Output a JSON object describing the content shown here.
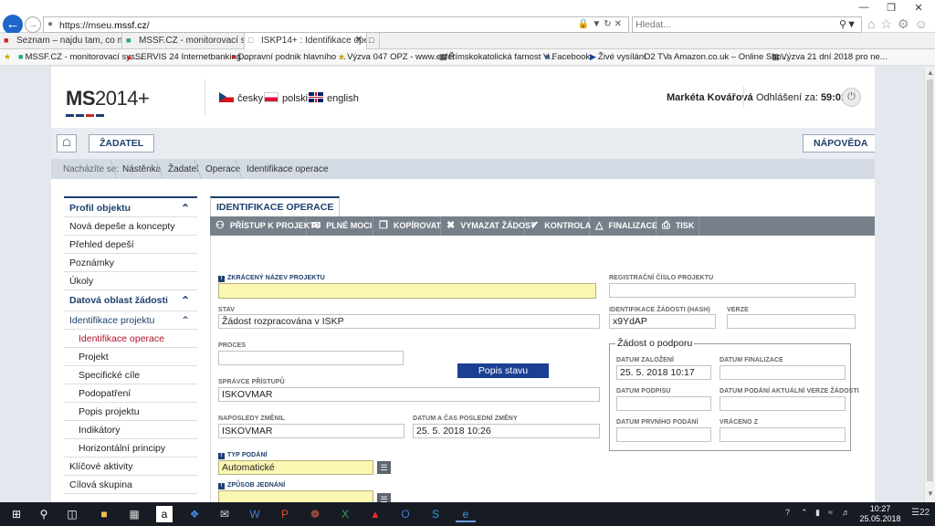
{
  "browser": {
    "url_prefix": "https://mseu.",
    "url_domain": "mssf.cz",
    "url_suffix": "/",
    "search_placeholder": "Hledat...",
    "tabs": [
      {
        "label": "Seznam – najdu tam, co neznám"
      },
      {
        "label": "MSSF.CZ - monitorovací syste..."
      },
      {
        "label": "ISKP14+ : Identifikace oper"
      }
    ],
    "favorites": [
      {
        "label": "MSSF.CZ - monitorovací sys..."
      },
      {
        "label": "SERVIS 24 Internetbanking ..."
      },
      {
        "label": "Dopravní podnik hlavního ..."
      },
      {
        "label": "Výzva 047 OPZ - www.esfcr"
      },
      {
        "label": "Římskokatolická farnost V..."
      },
      {
        "label": "Facebook"
      },
      {
        "label": "Živé vysílání"
      },
      {
        "label": "O2 TV"
      },
      {
        "label": "Amazon.co.uk – Online Sho..."
      },
      {
        "label": "Výzva 21 dní 2018 pro ne..."
      }
    ]
  },
  "header": {
    "logo_prefix": "MS",
    "logo_suffix": "2014+",
    "languages": [
      "česky",
      "polski",
      "english"
    ],
    "user": "Markéta Kovářová",
    "logout_label": "Odhlášení za:",
    "logout_time": "59:01"
  },
  "toolbar": {
    "zadatel": "ŽADATEL",
    "napoveda": "NÁPOVĚDA"
  },
  "breadcrumb": {
    "label": "Nacházíte se:",
    "items": [
      "Nástěnka",
      "Žadatel",
      "Operace",
      "Identifikace operace"
    ]
  },
  "sidebar": {
    "profil": "Profil objektu",
    "items1": [
      "Nová depeše a koncepty",
      "Přehled depeší",
      "Poznámky",
      "Úkoly"
    ],
    "datova": "Datová oblast žádosti",
    "identifikace_projektu": "Identifikace projektu",
    "sub": [
      "Identifikace operace",
      "Projekt",
      "Specifické cíle",
      "Podopatření",
      "Popis projektu",
      "Indikátory",
      "Horizontální principy"
    ],
    "items2": [
      "Klíčové aktivity",
      "Cílová skupina"
    ]
  },
  "content": {
    "tab": "IDENTIFIKACE OPERACE",
    "actions": [
      "PŘÍSTUP K PROJEKTU",
      "PLNÉ MOCI",
      "KOPÍROVAT",
      "VYMAZAT ŽÁDOST",
      "KONTROLA",
      "FINALIZACE",
      "TISK"
    ]
  },
  "form": {
    "zkraceny_nazev": {
      "label": "ZKRÁCENÝ NÁZEV PROJEKTU",
      "value": ""
    },
    "registracni_cislo": {
      "label": "REGISTRAČNÍ ČÍSLO PROJEKTU",
      "value": ""
    },
    "stav": {
      "label": "STAV",
      "value": "Žádost rozpracována v ISKP"
    },
    "hash": {
      "label": "IDENTIFIKACE ŽÁDOSTI (HASH)",
      "value": "x9YdAP"
    },
    "verze": {
      "label": "VERZE",
      "value": ""
    },
    "proces": {
      "label": "PROCES",
      "value": ""
    },
    "popis_stavu": "Popis stavu",
    "spravce": {
      "label": "SPRÁVCE PŘÍSTUPŮ",
      "value": "ISKOVMAR"
    },
    "naposledy": {
      "label": "NAPOSLEDY ZMĚNIL",
      "value": "ISKOVMAR"
    },
    "datum_zmeny": {
      "label": "DATUM A ČAS POSLEDNÍ ZMĚNY",
      "value": "25. 5. 2018 10:26"
    },
    "typ_podani": {
      "label": "TYP PODÁNÍ",
      "value": "Automatické"
    },
    "zpusob": {
      "label": "ZPŮSOB JEDNÁNÍ",
      "value": ""
    },
    "zadost_legend": "Žádost o podporu",
    "datum_zalozeni": {
      "label": "DATUM ZALOŽENÍ",
      "value": "25. 5. 2018 10:17"
    },
    "datum_finalizace": {
      "label": "DATUM FINALIZACE",
      "value": ""
    },
    "datum_podpisu": {
      "label": "DATUM PODPISU",
      "value": ""
    },
    "datum_podani_akt": {
      "label": "DATUM PODÁNÍ AKTUÁLNÍ VERZE ŽÁDOSTI",
      "value": ""
    },
    "datum_prvniho": {
      "label": "DATUM PRVNÍHO PODÁNÍ",
      "value": ""
    },
    "vraceno": {
      "label": "VRÁCENO Z",
      "value": ""
    }
  },
  "taskbar": {
    "time": "10:27",
    "date": "25.05.2018",
    "notifications": "22"
  },
  "colors": {
    "primary": "#1c3f6e",
    "active_link": "#b1132a",
    "required_field": "#fcf6b3",
    "action_bar": "#777f8a"
  }
}
